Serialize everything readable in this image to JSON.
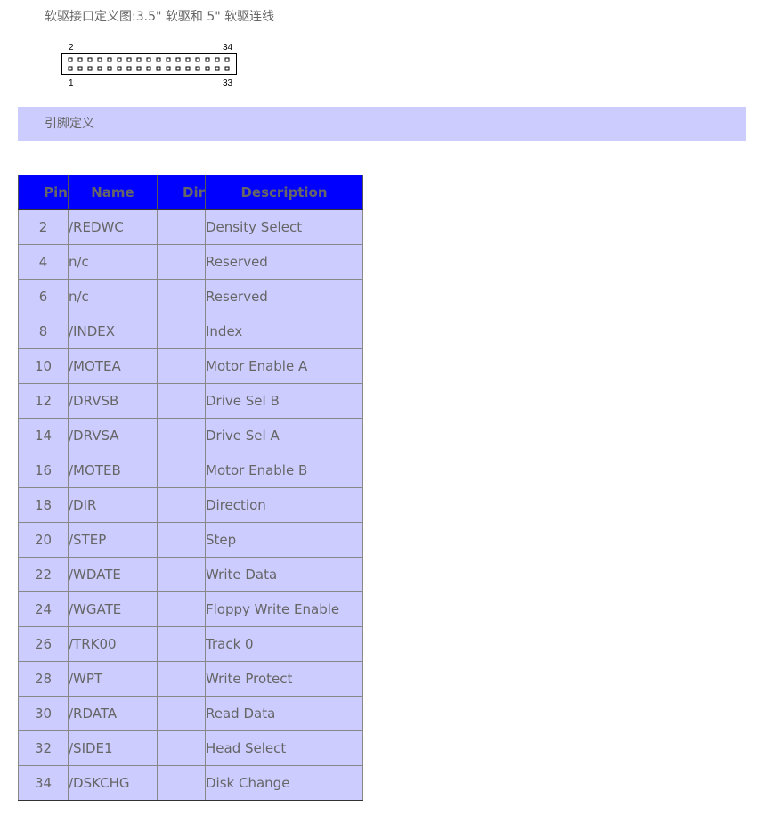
{
  "heading": "软驱接口定义图:3.5\" 软驱和 5\" 软驱连线",
  "connector": {
    "label_top_left": "2",
    "label_top_right": "34",
    "label_bottom_left": "1",
    "label_bottom_right": "33",
    "pins_per_row": 17,
    "rows": 2
  },
  "section_title": "引脚定义",
  "table": {
    "headers": {
      "pin": "Pin",
      "name": "Name",
      "dir": "Dir",
      "description": "Description"
    },
    "rows": [
      {
        "pin": "2",
        "name": "/REDWC",
        "dir": "",
        "description": "Density Select"
      },
      {
        "pin": "4",
        "name": "n/c",
        "dir": "",
        "description": "Reserved"
      },
      {
        "pin": "6",
        "name": "n/c",
        "dir": "",
        "description": "Reserved"
      },
      {
        "pin": "8",
        "name": "/INDEX",
        "dir": "",
        "description": "Index"
      },
      {
        "pin": "10",
        "name": "/MOTEA",
        "dir": "",
        "description": "Motor Enable A"
      },
      {
        "pin": "12",
        "name": "/DRVSB",
        "dir": "",
        "description": "Drive Sel B"
      },
      {
        "pin": "14",
        "name": "/DRVSA",
        "dir": "",
        "description": "Drive Sel A"
      },
      {
        "pin": "16",
        "name": "/MOTEB",
        "dir": "",
        "description": "Motor Enable B"
      },
      {
        "pin": "18",
        "name": "/DIR",
        "dir": "",
        "description": "Direction"
      },
      {
        "pin": "20",
        "name": "/STEP",
        "dir": "",
        "description": "Step"
      },
      {
        "pin": "22",
        "name": "/WDATE",
        "dir": "",
        "description": "Write Data"
      },
      {
        "pin": "24",
        "name": "/WGATE",
        "dir": "",
        "description": "Floppy Write Enable"
      },
      {
        "pin": "26",
        "name": "/TRK00",
        "dir": "",
        "description": "Track 0"
      },
      {
        "pin": "28",
        "name": "/WPT",
        "dir": "",
        "description": "Write Protect"
      },
      {
        "pin": "30",
        "name": "/RDATA",
        "dir": "",
        "description": "Read Data"
      },
      {
        "pin": "32",
        "name": "/SIDE1",
        "dir": "",
        "description": "Head Select"
      },
      {
        "pin": "34",
        "name": "/DSKCHG",
        "dir": "",
        "description": "Disk Change"
      }
    ]
  },
  "colors": {
    "header_background": "#0000ff",
    "row_background": "#ccccff",
    "section_bar_background": "#ccccff",
    "text": "#666666"
  }
}
